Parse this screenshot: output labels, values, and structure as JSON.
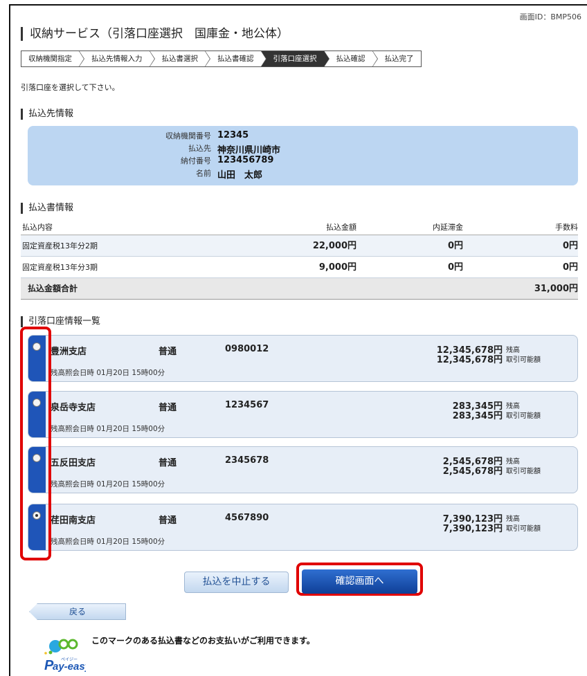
{
  "screen_id": "画面ID：BMP506",
  "title": "収納サービス（引落口座選択　国庫金・地公体）",
  "steps": [
    {
      "label": "収納機関指定",
      "active": false
    },
    {
      "label": "払込先情報入力",
      "active": false
    },
    {
      "label": "払込書選択",
      "active": false
    },
    {
      "label": "払込書確認",
      "active": false
    },
    {
      "label": "引落口座選択",
      "active": true
    },
    {
      "label": "払込確認",
      "active": false
    },
    {
      "label": "払込完了",
      "active": false
    }
  ],
  "instruction": "引落口座を選択して下さい。",
  "payee_section": {
    "title": "払込先情報",
    "rows": [
      {
        "label": "収納機関番号",
        "value": "12345"
      },
      {
        "label": "払込先",
        "value": "神奈川県川崎市"
      },
      {
        "label": "納付番号",
        "value": "123456789"
      },
      {
        "label": "名前",
        "value": "山田　太郎"
      }
    ]
  },
  "bill_section": {
    "title": "払込書情報",
    "headers": {
      "content": "払込内容",
      "amount": "払込金額",
      "late_fee": "内延滞金",
      "fee": "手数料"
    },
    "rows": [
      {
        "content": "固定資産税13年分2期",
        "amount": "22,000円",
        "late_fee": "0円",
        "fee": "0円"
      },
      {
        "content": "固定資産税13年分3期",
        "amount": "9,000円",
        "late_fee": "0円",
        "fee": "0円"
      }
    ],
    "total_label": "払込金額合計",
    "total_value": "31,000円"
  },
  "account_section": {
    "title": "引落口座情報一覧",
    "balance_label": "残高",
    "available_label": "取引可能額",
    "accounts": [
      {
        "branch": "豊洲支店",
        "type": "普通",
        "number": "0980012",
        "balance": "12,345,678円",
        "available": "12,345,678円",
        "time": "残高照会日時 01月20日 15時00分",
        "selected": false
      },
      {
        "branch": "泉岳寺支店",
        "type": "普通",
        "number": "1234567",
        "balance": "283,345円",
        "available": "283,345円",
        "time": "残高照会日時 01月20日 15時00分",
        "selected": false
      },
      {
        "branch": "五反田支店",
        "type": "普通",
        "number": "2345678",
        "balance": "2,545,678円",
        "available": "2,545,678円",
        "time": "残高照会日時 01月20日 15時00分",
        "selected": false
      },
      {
        "branch": "荏田南支店",
        "type": "普通",
        "number": "4567890",
        "balance": "7,390,123円",
        "available": "7,390,123円",
        "time": "残高照会日時 01月20日 15時00分",
        "selected": true
      }
    ]
  },
  "buttons": {
    "cancel": "払込を中止する",
    "confirm": "確認画面へ",
    "back": "戻る"
  },
  "payeasy": {
    "logo_text": "ay-easy",
    "logo_kana": "ペイジー",
    "text": "このマークのある払込書などのお支払いがご利用できます。"
  },
  "colors": {
    "accent_blue": "#1f55b8",
    "payee_box": "#bcd6f2",
    "highlight_red": "#e00000",
    "account_bg": "#e7eef7"
  }
}
